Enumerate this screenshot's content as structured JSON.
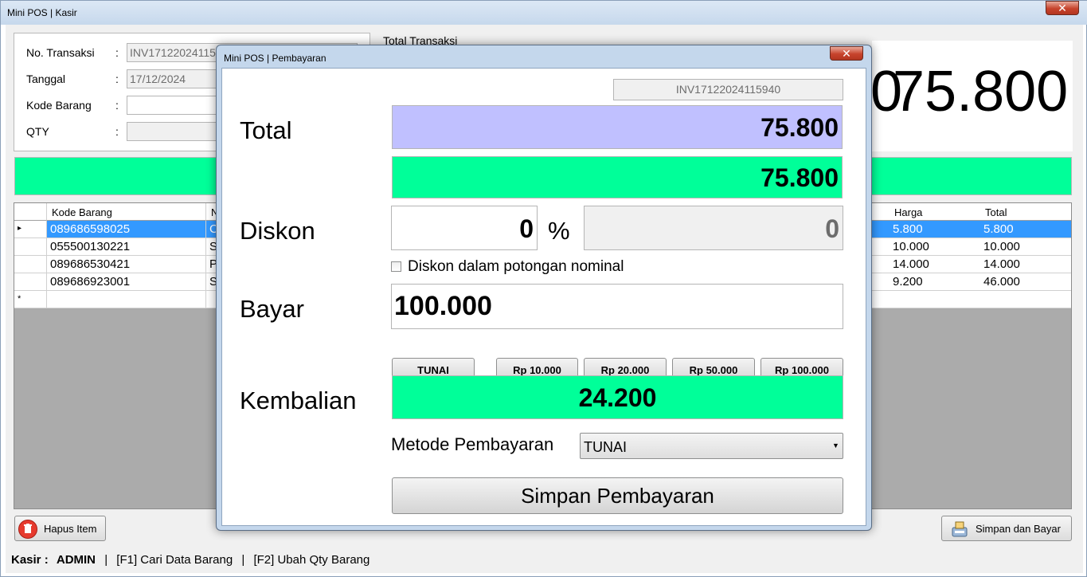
{
  "window": {
    "title": "Mini POS | Kasir",
    "close_label": "✕"
  },
  "form": {
    "no_transaksi_label": "No. Transaksi",
    "no_transaksi_value": "INV17122024115",
    "tanggal_label": "Tanggal",
    "tanggal_value": "17/12/2024",
    "kode_barang_label": "Kode Barang",
    "kode_barang_value": "",
    "qty_label": "QTY",
    "qty_value": "",
    "colon": ":"
  },
  "total_panel": {
    "label": "Total Transaksi",
    "value": "75.800",
    "partial_digit": "0"
  },
  "grid": {
    "columns": [
      "Kode Barang",
      "N",
      "Harga",
      "Total"
    ],
    "rows": [
      {
        "kode": "089686598025",
        "nama": "C",
        "harga": "5.800",
        "total": "5.800",
        "selected": true
      },
      {
        "kode": "055500130221",
        "nama": "S",
        "harga": "10.000",
        "total": "10.000",
        "selected": false
      },
      {
        "kode": "089686530421",
        "nama": "P",
        "harga": "14.000",
        "total": "14.000",
        "selected": false
      },
      {
        "kode": "089686923001",
        "nama": "S",
        "harga": "9.200",
        "total": "46.000",
        "selected": false
      }
    ],
    "new_row_marker": "*",
    "current_row_marker": "▸"
  },
  "buttons": {
    "hapus_item": "Hapus Item",
    "simpan_dan_bayar": "Simpan dan Bayar"
  },
  "statusbar": {
    "kasir_label": "Kasir :",
    "kasir_name": "ADMIN",
    "sep": "|",
    "hint_f1": "[F1] Cari Data Barang",
    "hint_f2": "[F2] Ubah Qty Barang"
  },
  "dialog": {
    "title": "Mini POS | Pembayaran",
    "close_label": "✕",
    "invoice": "INV17122024115940",
    "total_label": "Total",
    "total_value": "75.800",
    "total_after_value": "75.800",
    "diskon_label": "Diskon",
    "diskon_percent_value": "0",
    "percent_sign": "%",
    "diskon_nominal_value": "0",
    "diskon_checkbox_label": "Diskon dalam potongan nominal",
    "bayar_label": "Bayar",
    "bayar_value": "100.000",
    "quick_buttons": [
      "TUNAI",
      "Rp 10.000",
      "Rp 20.000",
      "Rp 50.000",
      "Rp 100.000"
    ],
    "kembalian_label": "Kembalian",
    "kembalian_value": "24.200",
    "metode_label": "Metode Pembayaran",
    "metode_value": "TUNAI",
    "simpan_label": "Simpan Pembayaran"
  },
  "colors": {
    "total_box": "#c0c0ff",
    "green": "#00ff99",
    "selection": "#3399ff"
  }
}
